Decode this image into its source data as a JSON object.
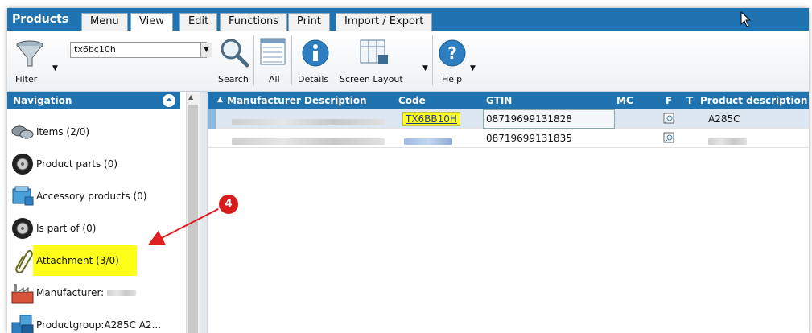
{
  "tabs": {
    "title": "Products",
    "items": [
      "Menu",
      "View",
      "Edit",
      "Functions",
      "Print",
      "Import / Export"
    ],
    "active": "View"
  },
  "toolbar": {
    "filter_label": "Filter",
    "search_value": "tx6bc10h",
    "search_label": "Search",
    "all_label": "All",
    "details_label": "Details",
    "screen_layout_label": "Screen Layout",
    "help_label": "Help"
  },
  "navigation": {
    "header": "Navigation",
    "items": [
      {
        "label": "Items (2/0)",
        "icon": "items-icon"
      },
      {
        "label": "Product parts (0)",
        "icon": "tire-icon"
      },
      {
        "label": "Accessory products (0)",
        "icon": "accessory-icon"
      },
      {
        "label": "Is part of (0)",
        "icon": "tire-icon"
      },
      {
        "label": "Attachment (3/0)",
        "icon": "paperclip-icon",
        "highlighted": true
      },
      {
        "label": "Manufacturer:",
        "icon": "factory-icon"
      },
      {
        "label": "Productgroup:A285C A2...",
        "icon": "cubes-icon"
      }
    ]
  },
  "grid": {
    "columns": [
      "Manufacturer Description",
      "Code",
      "GTIN",
      "MC",
      "F",
      "T",
      "Product description"
    ],
    "rows": [
      {
        "code": "TX6BB10H",
        "gtin": "08719699131828",
        "product_description": "A285C"
      },
      {
        "code": "",
        "gtin": "08719699131835",
        "product_description": ""
      }
    ]
  },
  "annotation": {
    "number": "4"
  },
  "colors": {
    "accent": "#1f73b0",
    "highlight": "#ffff1a",
    "annotation": "#d81b1b"
  }
}
